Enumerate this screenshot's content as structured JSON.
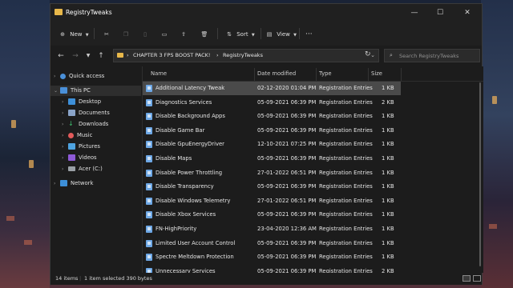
{
  "window": {
    "title": "RegistryTweaks"
  },
  "toolbar": {
    "new_label": "New",
    "sort_label": "Sort",
    "view_label": "View",
    "more_label": "···"
  },
  "address": {
    "crumbs": [
      "CHAPTER 3 FPS BOOST PACK!",
      "RegistryTweaks"
    ],
    "separator": "›"
  },
  "search": {
    "placeholder": "Search RegistryTweaks"
  },
  "nav": {
    "quick_access": "Quick access",
    "this_pc": "This PC",
    "items": [
      "Desktop",
      "Documents",
      "Downloads",
      "Music",
      "Pictures",
      "Videos",
      "Acer (C:)"
    ],
    "network": "Network"
  },
  "columns": {
    "name": "Name",
    "date": "Date modified",
    "type": "Type",
    "size": "Size"
  },
  "files": [
    {
      "name": "Additional Latency Tweak",
      "date": "02-12-2020 01:04 PM",
      "type": "Registration Entries",
      "size": "1 KB"
    },
    {
      "name": "Diagnostics Services",
      "date": "05-09-2021 06:39 PM",
      "type": "Registration Entries",
      "size": "2 KB"
    },
    {
      "name": "Disable Background Apps",
      "date": "05-09-2021 06:39 PM",
      "type": "Registration Entries",
      "size": "1 KB"
    },
    {
      "name": "Disable Game Bar",
      "date": "05-09-2021 06:39 PM",
      "type": "Registration Entries",
      "size": "1 KB"
    },
    {
      "name": "Disable GpuEnergyDriver",
      "date": "12-10-2021 07:25 PM",
      "type": "Registration Entries",
      "size": "1 KB"
    },
    {
      "name": "Disable Maps",
      "date": "05-09-2021 06:39 PM",
      "type": "Registration Entries",
      "size": "1 KB"
    },
    {
      "name": "Disable Power Throttling",
      "date": "27-01-2022 06:51 PM",
      "type": "Registration Entries",
      "size": "1 KB"
    },
    {
      "name": "Disable Transparency",
      "date": "05-09-2021 06:39 PM",
      "type": "Registration Entries",
      "size": "1 KB"
    },
    {
      "name": "Disable Windows Telemetry",
      "date": "27-01-2022 06:51 PM",
      "type": "Registration Entries",
      "size": "1 KB"
    },
    {
      "name": "Disable Xbox Services",
      "date": "05-09-2021 06:39 PM",
      "type": "Registration Entries",
      "size": "1 KB"
    },
    {
      "name": "FN-HighPriority",
      "date": "23-04-2020 12:36 AM",
      "type": "Registration Entries",
      "size": "1 KB"
    },
    {
      "name": "Limited User Account Control",
      "date": "05-09-2021 06:39 PM",
      "type": "Registration Entries",
      "size": "1 KB"
    },
    {
      "name": "Spectre Meltdown Protection",
      "date": "05-09-2021 06:39 PM",
      "type": "Registration Entries",
      "size": "1 KB"
    },
    {
      "name": "Unnecessary Services",
      "date": "05-09-2021 06:39 PM",
      "type": "Registration Entries",
      "size": "2 KB"
    }
  ],
  "status": {
    "items": "14 items",
    "selected": "1 item selected  390 bytes"
  },
  "colors": {
    "folder": "#e8b84a",
    "selection": "#4a4a4a",
    "background": "#1c1c1c"
  }
}
